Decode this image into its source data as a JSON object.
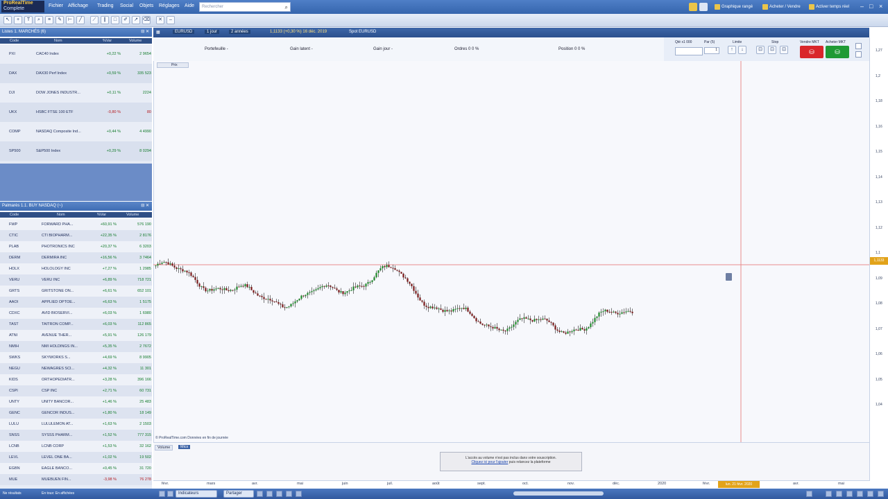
{
  "app": {
    "logo_line1": "ProRealTime",
    "logo_line2": "Complete",
    "menus": [
      "Fichier",
      "Affichage",
      "Trading",
      "Social",
      "Objets",
      "Réglages",
      "Aide"
    ],
    "search_placeholder": "Rechercher",
    "top_buttons": [
      "Graphique rangé",
      "Acheter / Vendre",
      "Activer temps réel"
    ],
    "window_controls": [
      "–",
      "□",
      "×"
    ]
  },
  "watchlist": {
    "title": "Listes  1. MARCHÉS (6)",
    "columns": [
      "Code",
      "Nom",
      "%Var",
      "Volume"
    ],
    "rows": [
      {
        "code": "PXI",
        "name": "CAC40 Index",
        "change": "+0,22 %",
        "volume": "2 9654",
        "dir": "pos"
      },
      {
        "code": "DAX",
        "name": "DAX30 Perf Index",
        "change": "+0,59 %",
        "volume": "335 523",
        "dir": "pos"
      },
      {
        "code": "DJI",
        "name": "DOW JONES INDUSTR...",
        "change": "+0,11 %",
        "volume": "2224",
        "dir": "pos"
      },
      {
        "code": "UKX",
        "name": "HSBC FTSE 100 ETF",
        "change": "-0,80 %",
        "volume": "80",
        "dir": "neg"
      },
      {
        "code": "COMP",
        "name": "NASDAQ Composite Ind...",
        "change": "+0,44 %",
        "volume": "4 4990",
        "dir": "pos"
      },
      {
        "code": "SP500",
        "name": "S&P500 Index",
        "change": "+0,29 %",
        "volume": "8 0294",
        "dir": "pos"
      }
    ]
  },
  "palmares": {
    "title": "Palmarès  1.1. BUY NASDAQ (~)",
    "columns": [
      "Code",
      "Nom",
      "%Var",
      "Volume"
    ],
    "rows": [
      {
        "code": "FWP",
        "name": "FORWARD PHA...",
        "change": "+60,91 %",
        "volume": "576 190",
        "dir": "pos"
      },
      {
        "code": "CTIC",
        "name": "CTI BIOPHARM...",
        "change": "+22,35 %",
        "volume": "2 8176",
        "dir": "pos"
      },
      {
        "code": "PLAB",
        "name": "PHOTRONICS INC",
        "change": "+20,37 %",
        "volume": "6 3203",
        "dir": "pos"
      },
      {
        "code": "DERM",
        "name": "DERMIRA INC",
        "change": "+16,56 %",
        "volume": "3 7464",
        "dir": "pos"
      },
      {
        "code": "HOLX",
        "name": "HOLOLOGY INC",
        "change": "+7,27 %",
        "volume": "1 2985",
        "dir": "pos"
      },
      {
        "code": "VERU",
        "name": "VERU INC",
        "change": "+6,89 %",
        "volume": "718 721",
        "dir": "pos"
      },
      {
        "code": "GRTS",
        "name": "GRITSTONE ON...",
        "change": "+6,61 %",
        "volume": "652 101",
        "dir": "pos"
      },
      {
        "code": "AAOI",
        "name": "APPLIED OPTOE...",
        "change": "+6,63 %",
        "volume": "1 5175",
        "dir": "pos"
      },
      {
        "code": "CDXC",
        "name": "AVID BIOSERVI...",
        "change": "+6,03 %",
        "volume": "1 6980",
        "dir": "pos"
      },
      {
        "code": "TAST",
        "name": "TAITRON COMP...",
        "change": "+6,03 %",
        "volume": "112 865",
        "dir": "pos"
      },
      {
        "code": "ATNI",
        "name": "AVENUE THER...",
        "change": "+5,91 %",
        "volume": "126 179",
        "dir": "pos"
      },
      {
        "code": "NMIH",
        "name": "NMI HOLDINGS IN...",
        "change": "+5,35 %",
        "volume": "2 7672",
        "dir": "pos"
      },
      {
        "code": "SWKS",
        "name": "SKYWORKS S...",
        "change": "+4,69 %",
        "volume": "8 9905",
        "dir": "pos"
      },
      {
        "code": "NEGU",
        "name": "NEWAGRES SCI...",
        "change": "+4,32 %",
        "volume": "11 301",
        "dir": "pos"
      },
      {
        "code": "KIDS",
        "name": "ORTHOPEDIATR...",
        "change": "+3,28 %",
        "volume": "396 166",
        "dir": "pos"
      },
      {
        "code": "CSPI",
        "name": "CSP INC",
        "change": "+2,71 %",
        "volume": "60 731",
        "dir": "pos"
      },
      {
        "code": "UNTY",
        "name": "UNITY BANCOR...",
        "change": "+1,46 %",
        "volume": "25 483",
        "dir": "pos"
      },
      {
        "code": "GENC",
        "name": "GENCOR INDUS...",
        "change": "+1,80 %",
        "volume": "18 149",
        "dir": "pos"
      },
      {
        "code": "LULU",
        "name": "LULULEMON AT...",
        "change": "+1,63 %",
        "volume": "2 1503",
        "dir": "pos"
      },
      {
        "code": "SNSS",
        "name": "SYSSS PHARM...",
        "change": "+1,52 %",
        "volume": "777 315",
        "dir": "pos"
      },
      {
        "code": "LCNB",
        "name": "LCNB CORP",
        "change": "+1,53 %",
        "volume": "32 162",
        "dir": "pos"
      },
      {
        "code": "LEVL",
        "name": "LEVEL ONE BA...",
        "change": "+1,02 %",
        "volume": "19 502",
        "dir": "pos"
      },
      {
        "code": "EGBN",
        "name": "EAGLE BANCO...",
        "change": "+0,45 %",
        "volume": "31 720",
        "dir": "pos"
      },
      {
        "code": "MUE",
        "name": "MUEBUEN FIN...",
        "change": "-3,98 %",
        "volume": "76 278",
        "dir": "neg"
      }
    ],
    "footer_left": "Ne résultats",
    "footer_right": "En toux: En affichées"
  },
  "chart": {
    "tabs": [
      "EURUSD",
      "1 jour",
      "2 années"
    ],
    "header_info": "1,1133 (+0,30 %)  16 déc. 2019",
    "header_name": "Spot EURUSD",
    "info_fields": [
      {
        "label": "Portefeuille",
        "value": "-"
      },
      {
        "label": "Gain latent",
        "value": "-"
      },
      {
        "label": "Gain jour",
        "value": "-"
      },
      {
        "label": "Ordres",
        "value": "0   0 %"
      },
      {
        "label": "Position",
        "value": "0   0 %"
      }
    ],
    "trade_labels": {
      "qty": "Qté x1 000",
      "pip": "Par (5)",
      "qty_value": "1",
      "limits": "Limite",
      "stop": "Stop",
      "sell": "Vendre MKT",
      "buy": "Acheter MKT"
    },
    "price_label": "Prix",
    "source_text": "© ProRealTime.com  Données en fin de journée",
    "volume_tab": "Volume",
    "volume_tab2": "Mics",
    "notice_text": "L'accès au volume n'est pas inclus dans votre souscription.",
    "notice_link": "Cliquez ici pour l'ajouter",
    "notice_link_suffix": "puis relancez la plateforme",
    "cursor_date": "lun. 21 févr. 2020",
    "price_cursor": "1,1133",
    "price_ticks": [
      "1,27",
      "1,2",
      "1,18",
      "1,16",
      "1,15",
      "1,14",
      "1,13",
      "1,12",
      "1,1",
      "1,09",
      "1,08",
      "1,07",
      "1,06",
      "1,05",
      "1,04"
    ],
    "time_ticks": [
      "févr.",
      "mars",
      "avr.",
      "mai",
      "juin",
      "juil.",
      "août",
      "sept.",
      "oct.",
      "nov.",
      "déc.",
      "2020",
      "févr.",
      "mars",
      "avr.",
      "mai"
    ]
  },
  "chart_data": {
    "type": "candlestick",
    "title": "EURUSD",
    "x": [
      "févr.",
      "mars",
      "avr.",
      "mai",
      "juin",
      "juil.",
      "août",
      "sept.",
      "oct.",
      "nov.",
      "déc.",
      "2020"
    ],
    "close": [
      1.143,
      1.132,
      1.122,
      1.119,
      1.129,
      1.139,
      1.112,
      1.103,
      1.102,
      1.101,
      1.113
    ],
    "ylim": [
      1.04,
      1.27
    ],
    "colors": {
      "up": "#1f8a2b",
      "down": "#7a1a1a",
      "cursor": "#e98b8b"
    }
  },
  "taskbar": {
    "tasks": [
      "Indicateurs",
      "Partager"
    ],
    "icons": [
      "zoom-icon",
      "window-icon",
      "grid-icon",
      "cube-icon",
      "layout-icon"
    ]
  }
}
